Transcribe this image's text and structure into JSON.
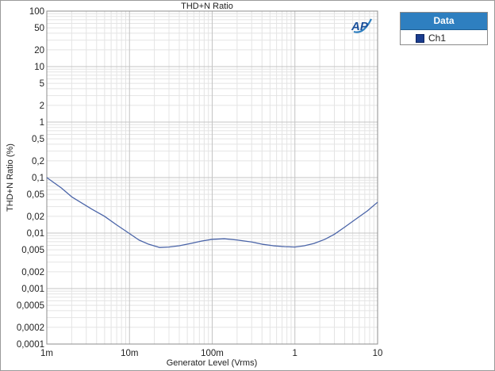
{
  "chart_data": {
    "type": "line",
    "title": "THD+N Ratio",
    "xlabel": "Generator Level (Vrms)",
    "ylabel": "THD+N Ratio (%)",
    "xscale": "log",
    "yscale": "log",
    "xlim": [
      0.001,
      10
    ],
    "ylim": [
      0.0001,
      100
    ],
    "grid": true,
    "legend_placement": "outside-top-right",
    "x_tick_labels": [
      {
        "value": 0.001,
        "label": "1m"
      },
      {
        "value": 0.01,
        "label": "10m"
      },
      {
        "value": 0.1,
        "label": "100m"
      },
      {
        "value": 1,
        "label": "1"
      },
      {
        "value": 10,
        "label": "10"
      }
    ],
    "y_tick_labels": [
      {
        "value": 100,
        "label": "100"
      },
      {
        "value": 50,
        "label": "50"
      },
      {
        "value": 20,
        "label": "20"
      },
      {
        "value": 10,
        "label": "10"
      },
      {
        "value": 5,
        "label": "5"
      },
      {
        "value": 2,
        "label": "2"
      },
      {
        "value": 1,
        "label": "1"
      },
      {
        "value": 0.5,
        "label": "0,5"
      },
      {
        "value": 0.2,
        "label": "0,2"
      },
      {
        "value": 0.1,
        "label": "0,1"
      },
      {
        "value": 0.05,
        "label": "0,05"
      },
      {
        "value": 0.02,
        "label": "0,02"
      },
      {
        "value": 0.01,
        "label": "0,01"
      },
      {
        "value": 0.005,
        "label": "0,005"
      },
      {
        "value": 0.002,
        "label": "0,002"
      },
      {
        "value": 0.001,
        "label": "0,001"
      },
      {
        "value": 0.0005,
        "label": "0,0005"
      },
      {
        "value": 0.0002,
        "label": "0,0002"
      },
      {
        "value": 0.0001,
        "label": "0,0001"
      }
    ],
    "series": [
      {
        "name": "Ch1",
        "color": "#4a64a8",
        "x": [
          0.001,
          0.0015,
          0.002,
          0.003,
          0.0035,
          0.005,
          0.007,
          0.01,
          0.013,
          0.017,
          0.023,
          0.03,
          0.04,
          0.055,
          0.075,
          0.1,
          0.14,
          0.2,
          0.3,
          0.4,
          0.55,
          0.75,
          1.0,
          1.3,
          1.7,
          2.3,
          3.0,
          4.0,
          5.5,
          7.5,
          10
        ],
        "y": [
          0.1,
          0.065,
          0.045,
          0.031,
          0.027,
          0.02,
          0.014,
          0.0098,
          0.0075,
          0.0063,
          0.0055,
          0.0056,
          0.0059,
          0.0065,
          0.0072,
          0.0077,
          0.0079,
          0.0075,
          0.0069,
          0.0063,
          0.0059,
          0.0057,
          0.0056,
          0.0059,
          0.0065,
          0.0077,
          0.0095,
          0.0128,
          0.018,
          0.025,
          0.036
        ]
      }
    ]
  },
  "legend": {
    "header": "Data",
    "items": [
      {
        "label": "Ch1",
        "color": "#1a3d8f"
      }
    ]
  },
  "logo": {
    "text": "AP"
  }
}
